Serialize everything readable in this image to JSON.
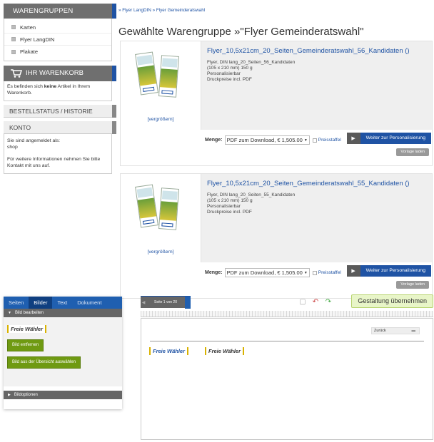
{
  "sidebar": {
    "groups_title": "WARENGRUPPEN",
    "groups": [
      "Karten",
      "Flyer LangDIN",
      "Plakate"
    ],
    "cart_title": "IHR WARENKORB",
    "cart_text_before": "Es befinden sich ",
    "cart_text_bold": "keine",
    "cart_text_after": " Artikel in Ihrem Warenkorb.",
    "order_status": "BESTELLSTATUS / HISTORIE",
    "account_title": "KONTO",
    "account_logged_in": "Sie sind angemeldet als:",
    "account_user": "shop",
    "account_info": "Für weitere Informationen nehmen Sie bitte Kontakt mit uns auf."
  },
  "breadcrumb": "» Flyer LangDIN » Flyer Gemeinderatswahl",
  "page_title": "Gewählte Warengruppe »\"Flyer Gemeinderatswahl\"",
  "products": [
    {
      "name": "Flyer_10,5x21cm_20_Seiten_Gemeinderatswahl_56_Kandidaten ()",
      "desc": [
        "Flyer, DIN lang_20_Seiten_56_Kandidaten",
        "(105 x 210 mm) 150 g",
        "Personalisierbar",
        "Druckpreise incl. PDF"
      ],
      "enlarge": "[vergrößern]",
      "menge_label": "Menge:",
      "select_value": "PDF zum Download, € 1,505.00",
      "preisstaffel": "Preisstaffel",
      "personal_btn": "Weiter zur Personalisierung",
      "vorlage_btn": "Vorlage laden"
    },
    {
      "name": "Flyer_10,5x21cm_20_Seiten_Gemeinderatswahl_55_Kandidaten ()",
      "desc": [
        "Flyer, DIN lang_20_Seiten_55_Kandidaten",
        "(105 x 210 mm) 150 g",
        "Personalisierbar",
        "Druckpreise incl. PDF"
      ],
      "enlarge": "[vergrößern]",
      "menge_label": "Menge:",
      "select_value": "PDF zum Download, € 1,505.00",
      "preisstaffel": "Preisstaffel",
      "personal_btn": "Weiter zur Personalisierung",
      "vorlage_btn": "Vorlage laden"
    }
  ],
  "editor": {
    "tabs": [
      "Seiten",
      "Bilder",
      "Text",
      "Dokument"
    ],
    "active_tab": "Bilder",
    "section_edit": "Bild bearbeiten",
    "logo_text": "Freie Wähler",
    "btn_remove": "Bild entfernen",
    "btn_choose": "Bild aus der Übersicht auswählen",
    "section_options": "Bildoptionen",
    "pager_text": "Seite 1 von 20",
    "apply_btn": "Gestaltung übernehmen",
    "back_select": "Zurück",
    "icons": [
      "page-icon",
      "undo-zoom-icon",
      "add-zoom-icon"
    ]
  },
  "colors": {
    "primary_blue": "#1f53a4",
    "header_gray": "#6f6f6f",
    "green_button": "#6f9a12",
    "apply_green": "#e8f5c8"
  }
}
